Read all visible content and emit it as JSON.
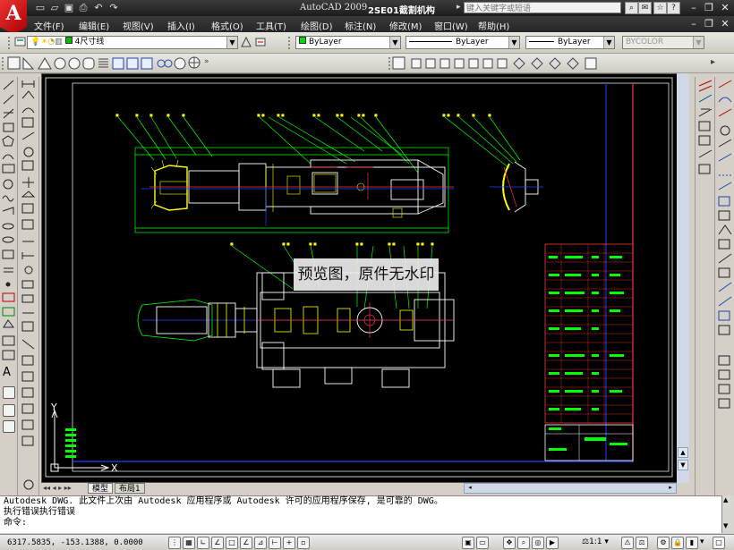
{
  "titlebar": {
    "app_name": "AutoCAD 2009",
    "file_name": "2SE01截割机构",
    "search_placeholder": "键入关键字或短语",
    "logo_letter": "A"
  },
  "menu": [
    "文件(F)",
    "编辑(E)",
    "视图(V)",
    "插入(I)",
    "格式(O)",
    "工具(T)",
    "绘图(D)",
    "标注(N)",
    "修改(M)",
    "窗口(W)",
    "帮助(H)"
  ],
  "layers_toolbar": {
    "current_layer": "4尺寸线",
    "color": "ByLayer",
    "linetype": "ByLayer",
    "lineweight": "ByLayer",
    "plotstyle": "BYCOLOR"
  },
  "tabs": [
    "模型",
    "布局1"
  ],
  "command": {
    "lines": [
      "Autodesk DWG.   此文件上次由 Autodesk 应用程序或 Autodesk 许可的应用程序保存, 是可靠的 DWG。",
      "执行错误执行错误"
    ],
    "prompt": "命令:"
  },
  "status": {
    "coordinates": "6317.5835, -153.1388, 0.0000",
    "scale": "1:1"
  },
  "watermark": "预览图，原件无水印",
  "ucs": {
    "y": "Y",
    "x": "X"
  },
  "colors": {
    "titlebar": "#2a2a2a",
    "canvas": "#000000",
    "drawing_green": "#00ff00",
    "drawing_white": "#ffffff",
    "drawing_yellow": "#ffff00",
    "drawing_red": "#ff0000",
    "drawing_blue": "#2040ff"
  }
}
